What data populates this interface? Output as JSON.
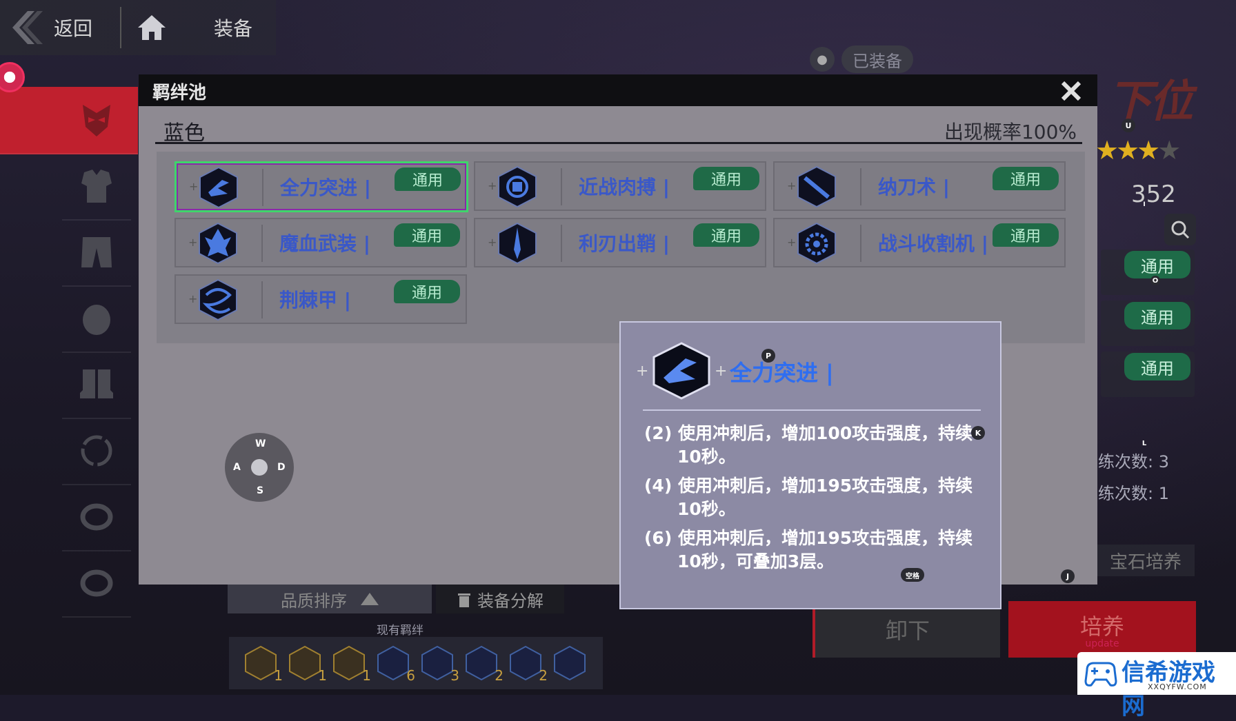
{
  "topbar": {
    "back_label": "返回",
    "title": "装备"
  },
  "behind": {
    "equipped_label": "已装备",
    "rank": "下位",
    "power": "352",
    "badges": [
      "通用",
      "通用",
      "通用"
    ],
    "stat_1": "练次数: 3",
    "stat_2": "练次数: 1",
    "gem_label": "宝石培养",
    "unequip_label": "卸下",
    "train_label": "培养",
    "train_sub": "update",
    "sort_label": "品质排序",
    "decompose_label": "装备分解",
    "owned_label": "现有羁绊",
    "owned_counts": [
      "1",
      "1",
      "1",
      "6",
      "3",
      "2",
      "2",
      ""
    ]
  },
  "modal": {
    "title": "羁绊池",
    "section": "蓝色",
    "probability": "出现概率100%",
    "bonds": [
      {
        "name": "全力突进 |",
        "badge": "通用",
        "icon": "dash-bond-icon",
        "selected": true
      },
      {
        "name": "近战肉搏 |",
        "badge": "通用",
        "icon": "fist-bond-icon",
        "selected": false
      },
      {
        "name": "纳刀术 |",
        "badge": "通用",
        "icon": "sheath-bond-icon",
        "selected": false
      },
      {
        "name": "魔血武装 |",
        "badge": "通用",
        "icon": "blood-armor-bond-icon",
        "selected": false
      },
      {
        "name": "利刃出鞘 |",
        "badge": "通用",
        "icon": "blade-bond-icon",
        "selected": false
      },
      {
        "name": "战斗收割机 |",
        "badge": "通用",
        "icon": "harvester-bond-icon",
        "selected": false
      },
      {
        "name": "荆棘甲 |",
        "badge": "通用",
        "icon": "thorn-armor-bond-icon",
        "selected": false
      }
    ]
  },
  "joystick": {
    "up": "W",
    "left": "A",
    "right": "D",
    "down": "S"
  },
  "tooltip": {
    "title": "全力突进 |",
    "effects": [
      "(2) 使用冲刺后，增加100攻击强度，持续10秒。",
      "(4) 使用冲刺后，增加195攻击强度，持续10秒。",
      "(6) 使用冲刺后，增加195攻击强度，持续10秒，可叠加3层。"
    ]
  },
  "key_hints": {
    "p": "P",
    "k": "K",
    "space": "空格",
    "j": "J",
    "u": "U",
    "i": "I",
    "o": "O",
    "l": "L"
  },
  "watermark": {
    "name": "信希游戏网",
    "url": "XXQYFW.COM"
  },
  "colors": {
    "accent_red": "#c0202e",
    "badge_green": "#1f6a47",
    "bond_blue": "#3a58c8"
  }
}
